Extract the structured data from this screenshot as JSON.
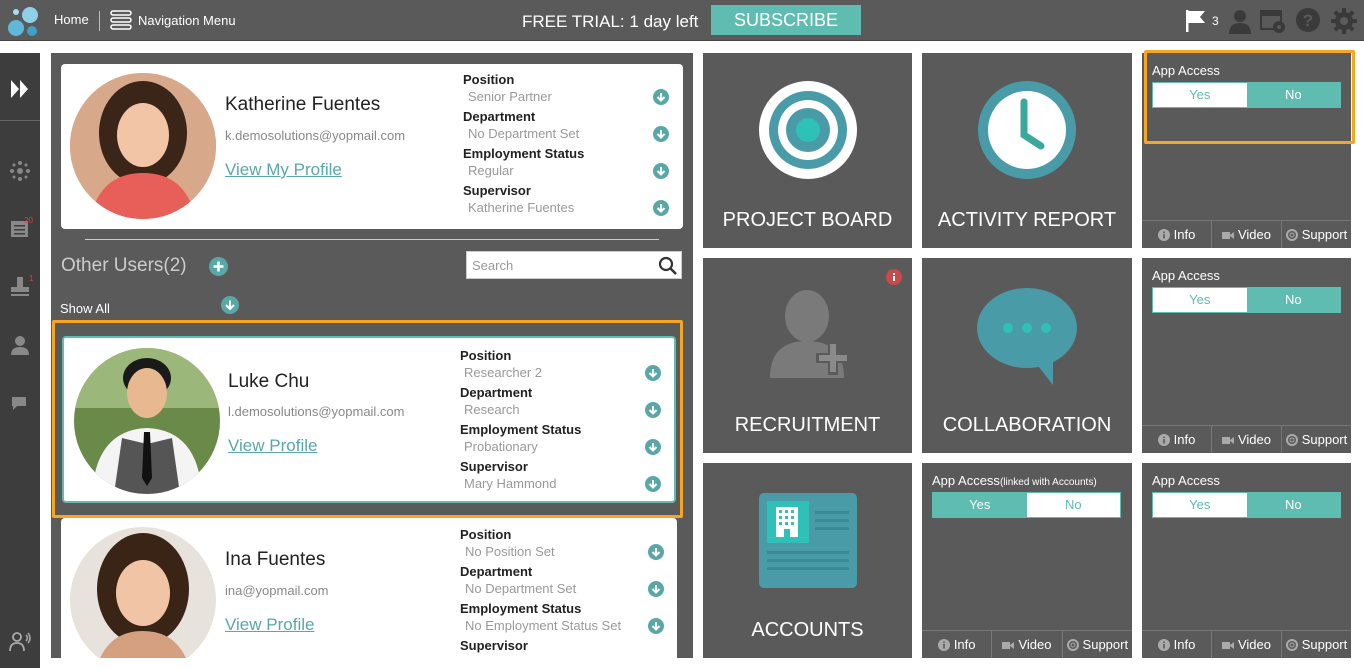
{
  "topbar": {
    "home": "Home",
    "nav_menu": "Navigation Menu",
    "trial_prefix": "FREE TRIAL: ",
    "trial_days": "1",
    "trial_suffix": " day left",
    "subscribe": "SUBSCRIBE",
    "flag_count": "3"
  },
  "rail": {
    "badge_1": "20",
    "badge_2": "1"
  },
  "me": {
    "name": "Katherine Fuentes",
    "email": "k.demosolutions@yopmail.com",
    "link": "View My Profile",
    "fields": [
      {
        "label": "Position",
        "value": "Senior Partner"
      },
      {
        "label": "Department",
        "value": "No Department Set"
      },
      {
        "label": "Employment Status",
        "value": "Regular"
      },
      {
        "label": "Supervisor",
        "value": "Katherine Fuentes"
      }
    ]
  },
  "other_users": {
    "title": "Other Users(2)",
    "search_placeholder": "Search",
    "show_all": "Show All"
  },
  "users": [
    {
      "name": "Luke Chu",
      "email": "l.demosolutions@yopmail.com",
      "link": "View Profile",
      "fields": [
        {
          "label": "Position",
          "value": "Researcher 2"
        },
        {
          "label": "Department",
          "value": "Research"
        },
        {
          "label": "Employment Status",
          "value": "Probationary"
        },
        {
          "label": "Supervisor",
          "value": "Mary Hammond"
        }
      ]
    },
    {
      "name": "Ina Fuentes",
      "email": "ina@yopmail.com",
      "link": "View Profile",
      "fields": [
        {
          "label": "Position",
          "value": "No Position Set"
        },
        {
          "label": "Department",
          "value": "No Department Set"
        },
        {
          "label": "Employment Status",
          "value": "No Employment Status Set"
        },
        {
          "label": "Supervisor",
          "value": ""
        }
      ]
    }
  ],
  "tiles": {
    "project_board": "PROJECT BOARD",
    "activity_report": "ACTIVITY REPORT",
    "recruitment": "RECRUITMENT",
    "collaboration": "COLLABORATION",
    "accounts": "ACCOUNTS"
  },
  "access": {
    "title": "App Access",
    "title_linked": "App Access",
    "linked_suffix": "(linked with Accounts)",
    "yes": "Yes",
    "no": "No",
    "info": "Info",
    "video": "Video",
    "support": "Support"
  },
  "colors": {
    "accent": "#5fbcb0",
    "highlight": "#f5a623",
    "panel": "#5a5a5a"
  }
}
